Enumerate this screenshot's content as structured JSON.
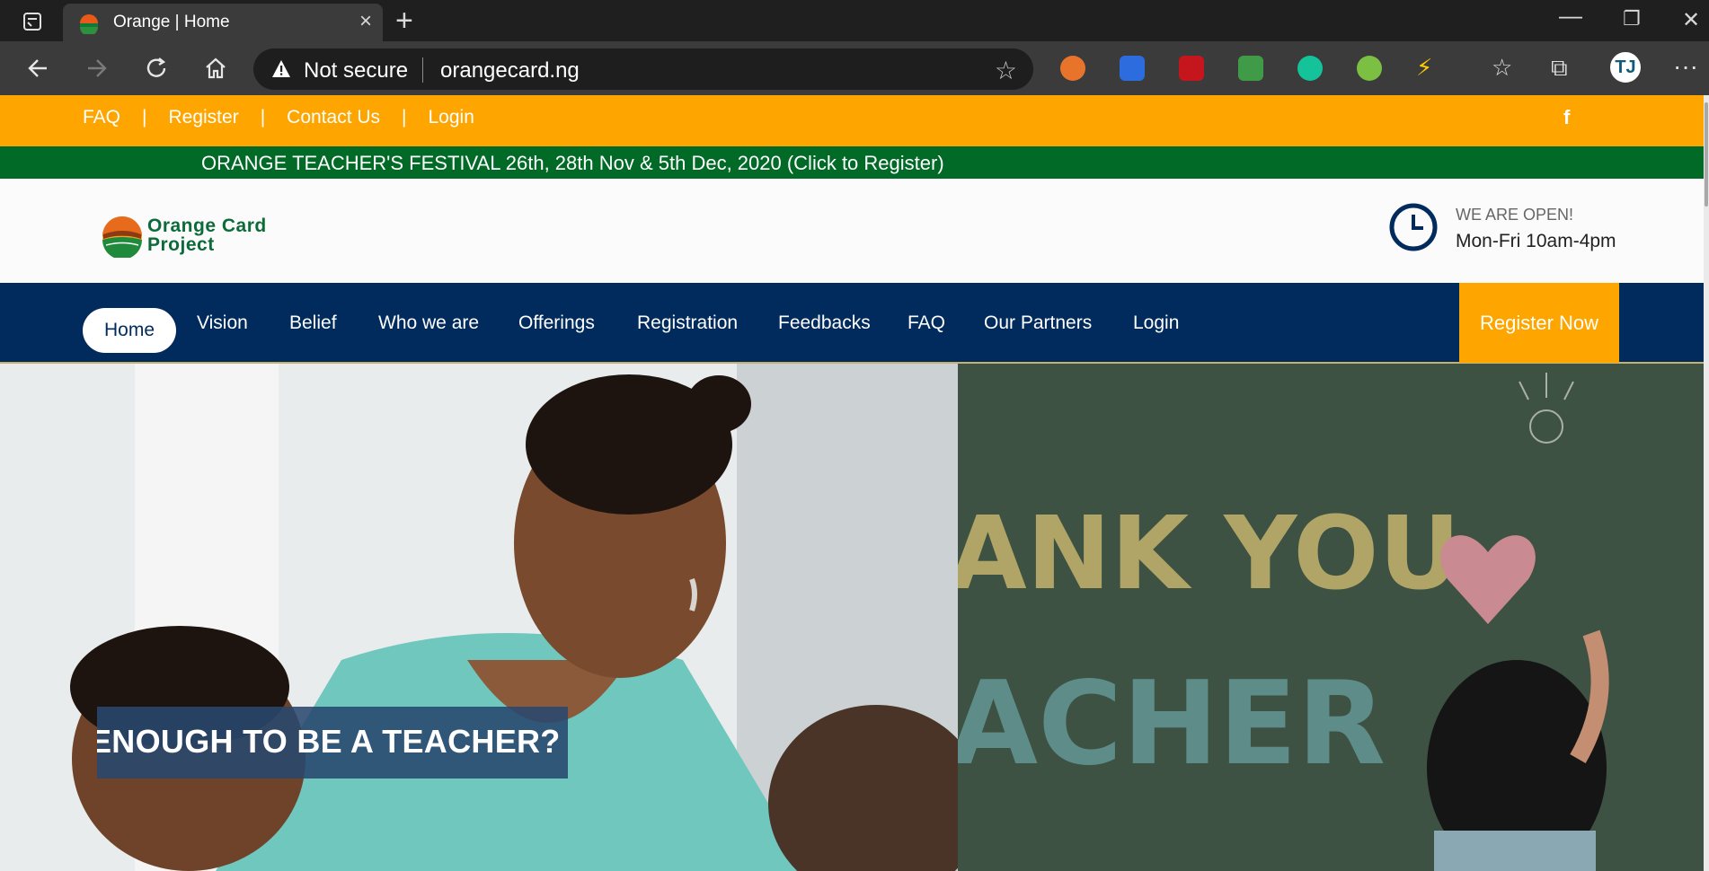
{
  "browser": {
    "tab_title": "Orange | Home",
    "tab_close": "×",
    "new_tab": "+",
    "security_text": "Not secure",
    "url": "orangecard.ng",
    "win_minimize": "—",
    "win_restore": "❐",
    "win_close": "✕",
    "profile_initials": "TJ",
    "more": "···"
  },
  "topbar": {
    "links": [
      "FAQ",
      "Register",
      "Contact Us",
      "Login"
    ],
    "separator": "|",
    "facebook": "f"
  },
  "festival": {
    "text": "ORANGE TEACHER'S FESTIVAL 26th, 28th Nov & 5th Dec, 2020 (Click to Register)"
  },
  "header": {
    "logo_line1": "Orange Card",
    "logo_line2": "Project",
    "open_label": "WE ARE OPEN!",
    "open_hours": "Mon-Fri 10am-4pm"
  },
  "nav": {
    "items": [
      "Home",
      "Vision",
      "Belief",
      "Who we are",
      "Offerings",
      "Registration",
      "Feedbacks",
      "FAQ",
      "Our Partners",
      "Login"
    ],
    "cta": "Register Now"
  },
  "hero": {
    "caption": "ENOUGH TO BE A TEACHER?",
    "chalk_line1": "ANK YOU",
    "chalk_line2": "ACHER"
  },
  "colors": {
    "orange": "#ffa500",
    "green": "#016a26",
    "navy": "#002b5c",
    "caption_bg": "#29486e"
  }
}
